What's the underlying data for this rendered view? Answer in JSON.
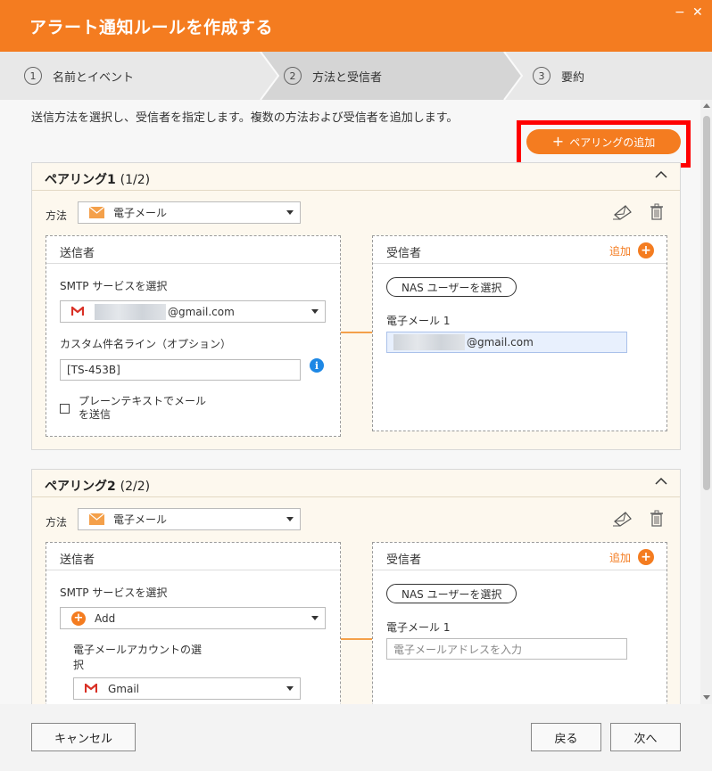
{
  "window": {
    "title": "アラート通知ルールを作成する",
    "minimize": "−",
    "close": "✕"
  },
  "steps": [
    {
      "num": "1",
      "label": "名前とイベント"
    },
    {
      "num": "2",
      "label": "方法と受信者"
    },
    {
      "num": "3",
      "label": "要約"
    }
  ],
  "instructions": "送信方法を選択し、受信者を指定します。複数の方法および受信者を追加します。",
  "add_pairing_label": "ペアリングの追加",
  "pairings": [
    {
      "title": "ペアリング1",
      "count": "(1/2)",
      "method_label": "方法",
      "method_value": "電子メール",
      "sender": {
        "title": "送信者",
        "smtp_label": "SMTP サービスを選択",
        "smtp_value": "@gmail.com",
        "subject_label": "カスタム件名ライン（オプション）",
        "subject_value": "[TS-453B]",
        "plain_text_label_1": "プレーンテキストでメール",
        "plain_text_label_2": "を送信"
      },
      "recipient": {
        "title": "受信者",
        "add_label": "追加",
        "nas_button": "NAS ユーザーを選択",
        "email_label": "電子メール 1",
        "email_value": "@gmail.com"
      }
    },
    {
      "title": "ペアリング2",
      "count": "(2/2)",
      "method_label": "方法",
      "method_value": "電子メール",
      "sender": {
        "title": "送信者",
        "smtp_label": "SMTP サービスを選択",
        "smtp_value": "Add",
        "account_label_1": "電子メールアカウントの選",
        "account_label_2": "択",
        "account_value": "Gmail"
      },
      "recipient": {
        "title": "受信者",
        "add_label": "追加",
        "nas_button": "NAS ユーザーを選択",
        "email_label": "電子メール 1",
        "email_placeholder": "電子メールアドレスを入力"
      }
    }
  ],
  "footer": {
    "cancel": "キャンセル",
    "back": "戻る",
    "next": "次へ"
  },
  "colors": {
    "accent": "#f47c20",
    "highlight": "#ff0000",
    "info": "#1e88e5"
  }
}
